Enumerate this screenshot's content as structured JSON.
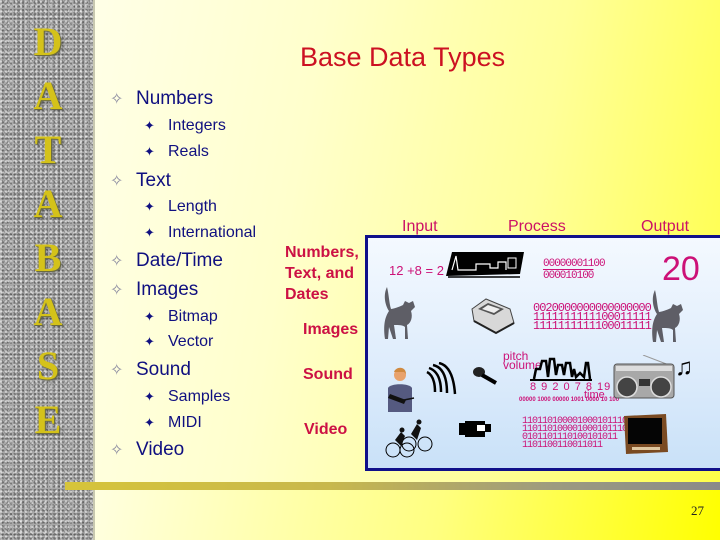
{
  "slide": {
    "title": "Base Data Types",
    "vertical_title": [
      "D",
      "A",
      "T",
      "A",
      "B",
      "A",
      "S",
      "E"
    ],
    "page_number": "27"
  },
  "bullets": [
    {
      "level": 1,
      "text": "Numbers"
    },
    {
      "level": 2,
      "text": "Integers"
    },
    {
      "level": 2,
      "text": "Reals"
    },
    {
      "level": 1,
      "text": "Text"
    },
    {
      "level": 2,
      "text": "Length"
    },
    {
      "level": 2,
      "text": "International"
    },
    {
      "level": 1,
      "text": "Date/Time"
    },
    {
      "level": 1,
      "text": "Images"
    },
    {
      "level": 2,
      "text": "Bitmap"
    },
    {
      "level": 2,
      "text": "Vector"
    },
    {
      "level": 1,
      "text": "Sound"
    },
    {
      "level": 2,
      "text": "Samples"
    },
    {
      "level": 2,
      "text": "MIDI"
    },
    {
      "level": 1,
      "text": "Video"
    }
  ],
  "diagram": {
    "column_headers": {
      "input": "Input",
      "process": "Process",
      "output": "Output"
    },
    "row_labels": {
      "numbers_line1": "Numbers,",
      "numbers_line2": "Text, and",
      "numbers_line3": "Dates",
      "images": "Images",
      "sound": "Sound",
      "video": "Video"
    },
    "numbers_row": {
      "input_text": "12 +8 = 2",
      "binary_line1": "00000001100",
      "binary_line2": "000010100",
      "output_value": "20"
    },
    "images_row": {
      "binary_line1": "0020000000000000000",
      "binary_line2": "1111111111100011111"
    },
    "sound_row": {
      "pitch_label": "pitch",
      "volume_label": "volume",
      "note_numbers": "8 9 2 0 7 8 19 5 6 1",
      "time_label": "time",
      "binary_stream": "00000 1000 00000 1001 0000 10 100"
    },
    "video_row": {
      "binary_line1": "1101101000010001011101011",
      "binary_line2": "0101101110100101011",
      "binary_line3": "1101100110011011"
    },
    "icons": [
      "keyboard-icon",
      "cat-icon",
      "scanner-icon",
      "presenter-icon",
      "sound-waves-icon",
      "microphone-icon",
      "boombox-icon",
      "music-note-icon",
      "cyclists-icon",
      "video-camera-icon",
      "television-icon"
    ]
  },
  "colors": {
    "title": "#cc1122",
    "bullet_text": "#101080",
    "diagram_label": "#cc1144",
    "binary": "#cc1177",
    "panel_border": "#10108a",
    "vertical_title": "#d4c21a"
  }
}
